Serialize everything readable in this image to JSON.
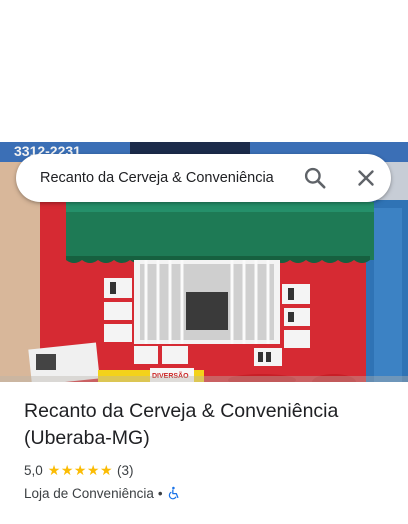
{
  "search": {
    "query": "Recanto da Cerveja & Conveniência"
  },
  "place": {
    "name": "Recanto da Cerveja & Conveniência (Uberaba-MG)",
    "rating": "5,0",
    "stars": "★★★★★",
    "review_count": "(3)",
    "category": "Loja de Conveniência",
    "separator": "•"
  },
  "photo": {
    "sign_phone": "3312-2231",
    "promo_text": "DIVERSÃO"
  },
  "colors": {
    "star": "#fbbc04",
    "accessibility_icon": "#1a73e8",
    "wall_red": "#d62a33",
    "awning_green": "#1e7a55"
  },
  "icons": [
    "search-icon",
    "close-icon",
    "wheelchair-icon"
  ]
}
